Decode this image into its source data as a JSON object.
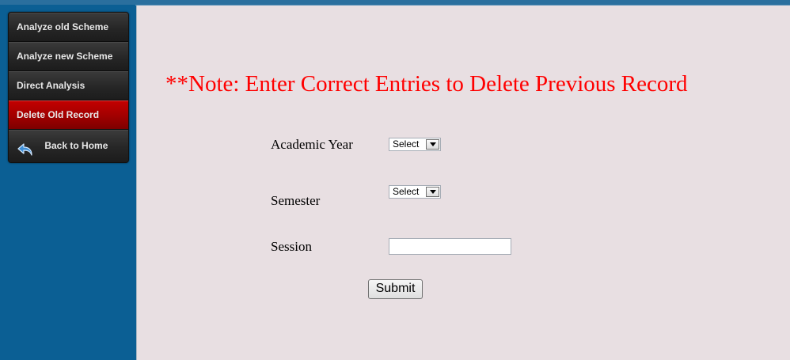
{
  "sidebar": {
    "items": [
      {
        "label": "Analyze old Scheme"
      },
      {
        "label": "Analyze new Scheme"
      },
      {
        "label": "Direct Analysis"
      },
      {
        "label": "Delete Old Record",
        "active": true
      },
      {
        "label": "Back to Home",
        "icon": "back-arrow-icon"
      }
    ]
  },
  "main": {
    "note": "**Note: Enter Correct Entries to Delete Previous Record",
    "form": {
      "academic_year_label": "Academic Year",
      "academic_year_value": "Select",
      "semester_label": "Semester",
      "semester_value": "Select",
      "session_label": "Session",
      "session_value": "",
      "submit_label": "Submit"
    }
  },
  "colors": {
    "note": "#ff0000",
    "active_menu": "#b00000",
    "sidebar_bg": "#0b5f94",
    "content_bg": "#e8dfe2"
  }
}
